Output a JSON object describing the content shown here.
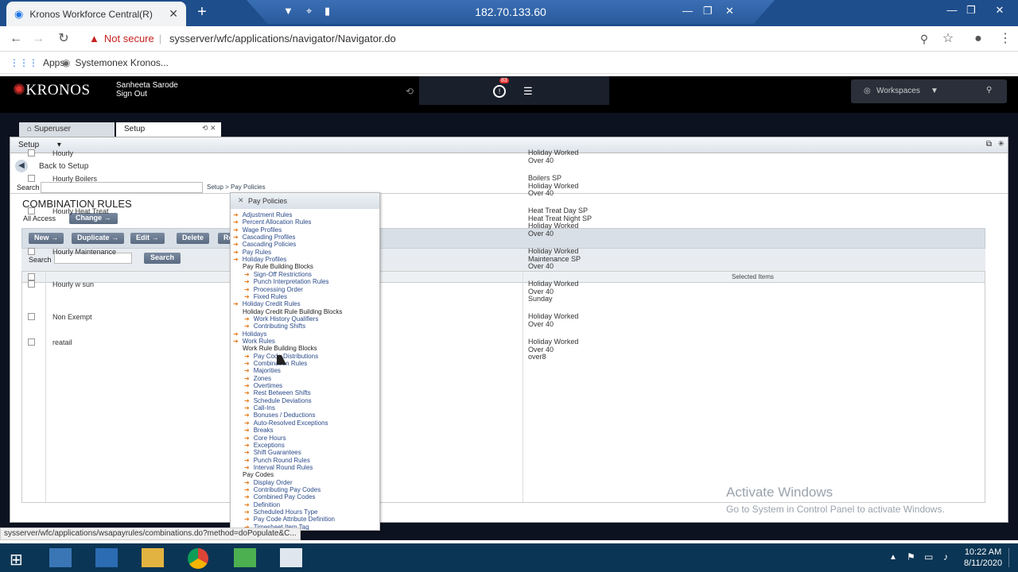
{
  "browser": {
    "tab_title": "Kronos Workforce Central(R)",
    "remote_ip": "182.70.133.60",
    "not_secure": "Not secure",
    "url": "sysserver/wfc/applications/navigator/Navigator.do",
    "bookmarks": [
      "Apps",
      "Systemonex Kronos..."
    ],
    "status_url": "sysserver/wfc/applications/wsapayrules/combinations.do?method=doPopulate&C..."
  },
  "kronos": {
    "logo": "KRONOS",
    "user_name": "Sanheeta Sarode",
    "sign_out": "Sign Out",
    "notification_count": "83",
    "workspaces_label": "Workspaces",
    "tabs": [
      "Superuser",
      "Setup"
    ]
  },
  "panel": {
    "title": "Setup",
    "back_label": "Back to Setup",
    "search_label": "Search",
    "breadcrumb": "Setup > Pay Policies",
    "page_title": "COMBINATION RULES",
    "access_label": "All Access",
    "change_label": "Change",
    "toolbar": [
      "New",
      "Duplicate",
      "Edit",
      "Delete",
      "Re"
    ],
    "grid_search_label": "Search",
    "search_button": "Search",
    "selected_items_header": "Selected Items",
    "rows": [
      {
        "name": "Hourly",
        "selected": [
          "Holiday Worked",
          "Over 40"
        ]
      },
      {
        "name": "Hourly Boilers",
        "selected": [
          "Boilers SP",
          "Holiday Worked",
          "Over 40"
        ]
      },
      {
        "name": "Hourly Heat Treat",
        "selected": [
          "Heat Treat Day SP",
          "Heat Treat Night SP",
          "Holiday Worked",
          "Over 40"
        ]
      },
      {
        "name": "Hourly Maintenance",
        "selected": [
          "Holiday Worked",
          "Maintenance SP",
          "Over 40"
        ]
      },
      {
        "name": "Hourly w sun",
        "selected": [
          "Holiday Worked",
          "Over 40",
          "Sunday"
        ]
      },
      {
        "name": "Non Exempt",
        "selected": [
          "Holiday Worked",
          "Over 40"
        ]
      },
      {
        "name": "reatail",
        "selected": [
          "Holiday Worked",
          "Over 40",
          "over8"
        ]
      }
    ]
  },
  "popup": {
    "title": "Pay Policies",
    "items": [
      {
        "label": "Adjustment Rules",
        "level": 1
      },
      {
        "label": "Percent Allocation Rules",
        "level": 1
      },
      {
        "label": "Wage Profiles",
        "level": 1
      },
      {
        "label": "Cascading Profiles",
        "level": 1
      },
      {
        "label": "Cascading Policies",
        "level": 1
      },
      {
        "label": "Pay Rules",
        "level": 1
      },
      {
        "label": "Holiday Profiles",
        "level": 1
      },
      {
        "label": "Pay Rule Building Blocks",
        "level": 0
      },
      {
        "label": "Sign-Off Restrictions",
        "level": 2
      },
      {
        "label": "Punch Interpretation Rules",
        "level": 2
      },
      {
        "label": "Processing Order",
        "level": 2
      },
      {
        "label": "Fixed Rules",
        "level": 2
      },
      {
        "label": "Holiday Credit Rules",
        "level": 1
      },
      {
        "label": "Holiday Credit Rule Building Blocks",
        "level": 0
      },
      {
        "label": "Work History Qualifiers",
        "level": 2
      },
      {
        "label": "Contributing Shifts",
        "level": 2
      },
      {
        "label": "Holidays",
        "level": 1
      },
      {
        "label": "Work Rules",
        "level": 1
      },
      {
        "label": "Work Rule Building Blocks",
        "level": 0
      },
      {
        "label": "Pay Code Distributions",
        "level": 2
      },
      {
        "label": "Combination Rules",
        "level": 2
      },
      {
        "label": "Majorities",
        "level": 2
      },
      {
        "label": "Zones",
        "level": 2
      },
      {
        "label": "Overtimes",
        "level": 2
      },
      {
        "label": "Rest Between Shifts",
        "level": 2
      },
      {
        "label": "Schedule Deviations",
        "level": 2
      },
      {
        "label": "Call-Ins",
        "level": 2
      },
      {
        "label": "Bonuses / Deductions",
        "level": 2
      },
      {
        "label": "Auto-Resolved Exceptions",
        "level": 2
      },
      {
        "label": "Breaks",
        "level": 2
      },
      {
        "label": "Core Hours",
        "level": 2
      },
      {
        "label": "Exceptions",
        "level": 2
      },
      {
        "label": "Shift Guarantees",
        "level": 2
      },
      {
        "label": "Punch Round Rules",
        "level": 2
      },
      {
        "label": "Interval Round Rules",
        "level": 2
      },
      {
        "label": "Pay Codes",
        "level": 0
      },
      {
        "label": "Display Order",
        "level": 2
      },
      {
        "label": "Contributing Pay Codes",
        "level": 2
      },
      {
        "label": "Combined Pay Codes",
        "level": 2
      },
      {
        "label": "Definition",
        "level": 2
      },
      {
        "label": "Scheduled Hours Type",
        "level": 2
      },
      {
        "label": "Pay Code Attribute Definition",
        "level": 2
      },
      {
        "label": "Timesheet Item Tag",
        "level": 2
      }
    ]
  },
  "watermark": {
    "line1": "Activate Windows",
    "line2": "Go to System in Control Panel to activate Windows."
  },
  "taskbar": {
    "time": "10:22 AM",
    "date": "8/11/2020"
  }
}
